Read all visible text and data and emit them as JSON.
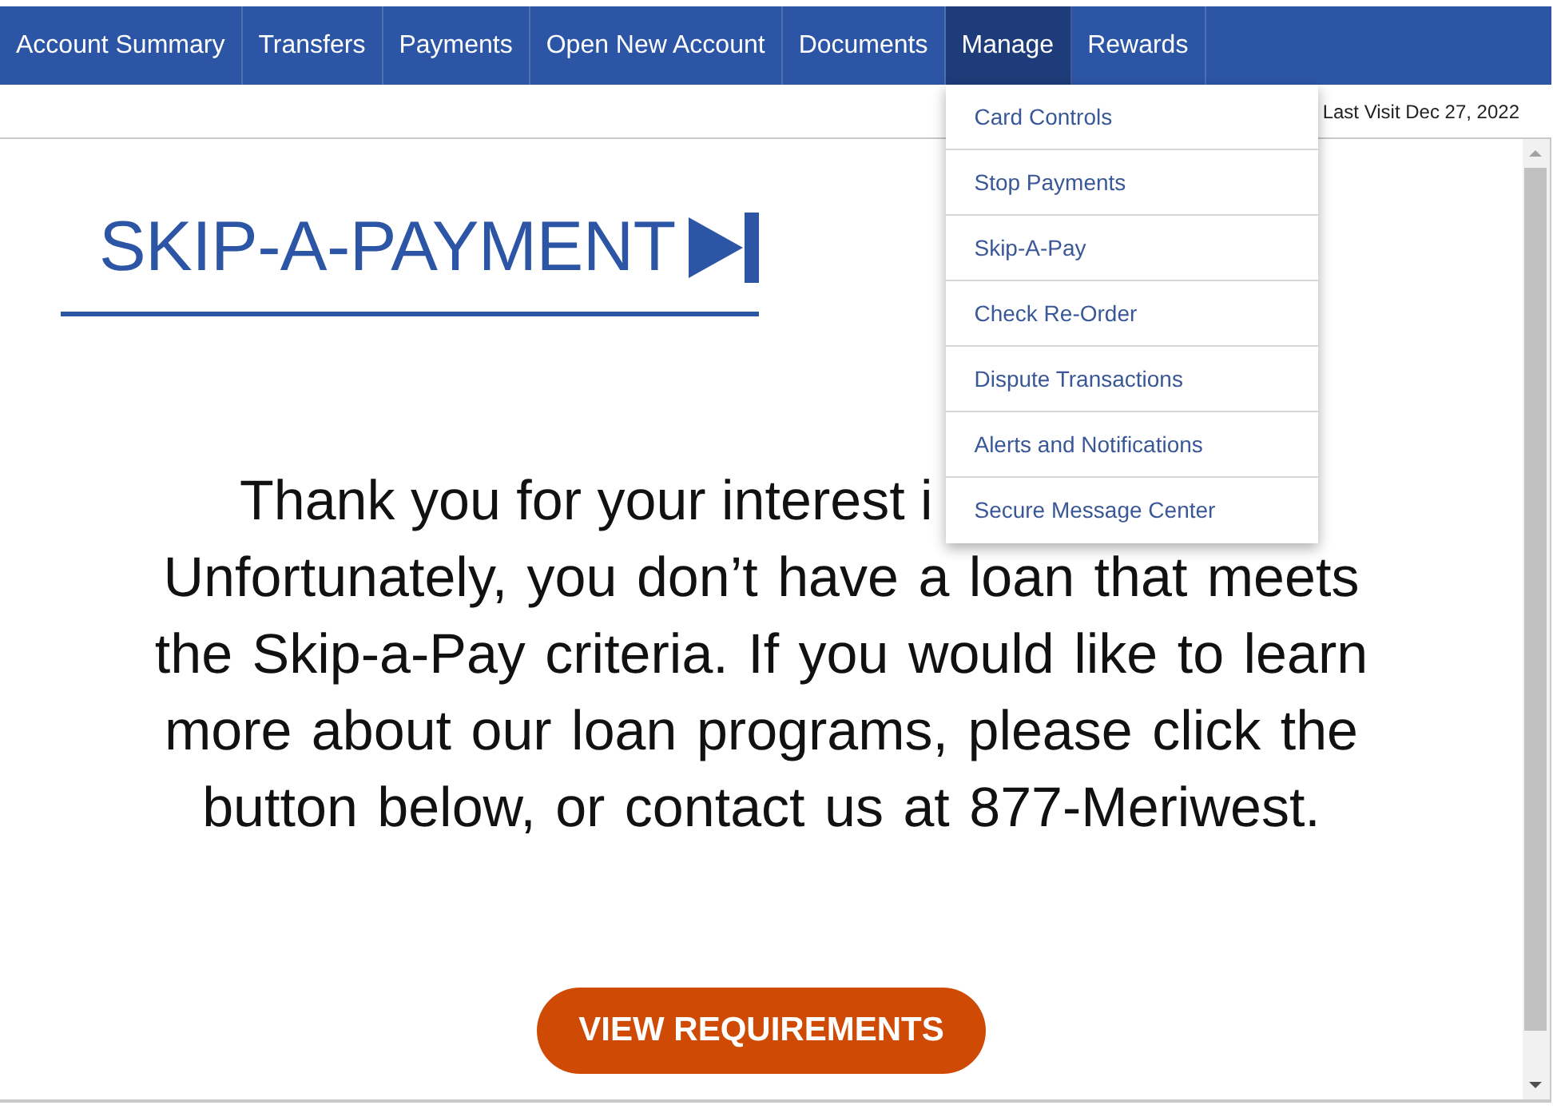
{
  "nav": {
    "items": [
      {
        "label": "Account Summary",
        "selected": false
      },
      {
        "label": "Transfers",
        "selected": false
      },
      {
        "label": "Payments",
        "selected": false
      },
      {
        "label": "Open New Account",
        "selected": false
      },
      {
        "label": "Documents",
        "selected": false
      },
      {
        "label": "Manage",
        "selected": true,
        "expanded": true
      },
      {
        "label": "Rewards",
        "selected": false
      }
    ]
  },
  "dropdown": {
    "items": [
      "Card Controls",
      "Stop Payments",
      "Skip-A-Pay",
      "Check Re-Order",
      "Dispute Transactions",
      "Alerts and Notifications",
      "Secure Message Center"
    ]
  },
  "last_visit": "Last Visit Dec 27, 2022",
  "page": {
    "title": "SKIP-A-PAYMENT",
    "message_first_line": "Thank you for your interest i",
    "message": "Unfortunately, you don’t have a loan that meets the Skip-a-Pay criteria. If you would like to learn more about our loan programs, please click the button below, or contact us at 877-Meriwest.",
    "button": "VIEW REQUIREMENTS"
  }
}
